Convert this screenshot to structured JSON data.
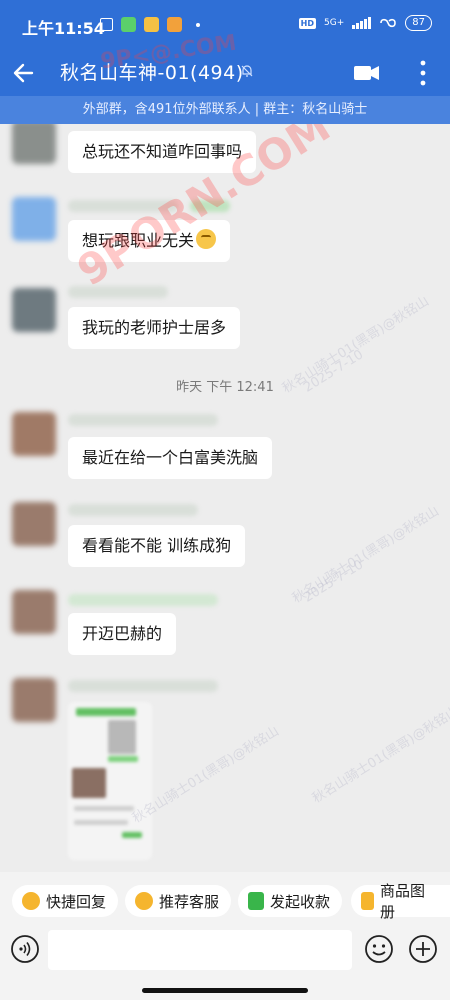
{
  "status_bar": {
    "time": "上午11:54",
    "network": "5G+",
    "battery": "87"
  },
  "header": {
    "title": "秋名山车神-01(494)"
  },
  "info_bar": {
    "text": "外部群，含491位外部联系人 | 群主：秋名山骑士"
  },
  "messages": [
    {
      "text": "总玩还不知道咋回事吗"
    },
    {
      "text": "想玩跟职业无关",
      "emoji": "thinking-face"
    },
    {
      "text": "我玩的老师护士居多"
    },
    {
      "text": "最近在给一个白富美洗脑"
    },
    {
      "text": "看看能不能 训练成狗"
    },
    {
      "text": "开迈巴赫的"
    }
  ],
  "timestamp": "昨天 下午 12:41",
  "watermarks": {
    "site": "9PORN.COM",
    "site_top": "9P<@.COM",
    "group": "秋名山骑士01(黑哥)@秋铭山",
    "date": "2025-7-10"
  },
  "quick_actions": [
    {
      "label": "快捷回复",
      "icon": "quick-reply-icon",
      "color": "#f5b52e"
    },
    {
      "label": "推荐客服",
      "icon": "recommend-service-icon",
      "color": "#f5b52e"
    },
    {
      "label": "发起收款",
      "icon": "payment-icon",
      "color": "#39b54a"
    },
    {
      "label": "商品图册",
      "icon": "product-album-icon",
      "color": "#f5b52e"
    }
  ],
  "colors": {
    "header": "#2f6fd6",
    "info_bar": "#4a83de",
    "background": "#ededed",
    "bubble": "#ffffff"
  }
}
